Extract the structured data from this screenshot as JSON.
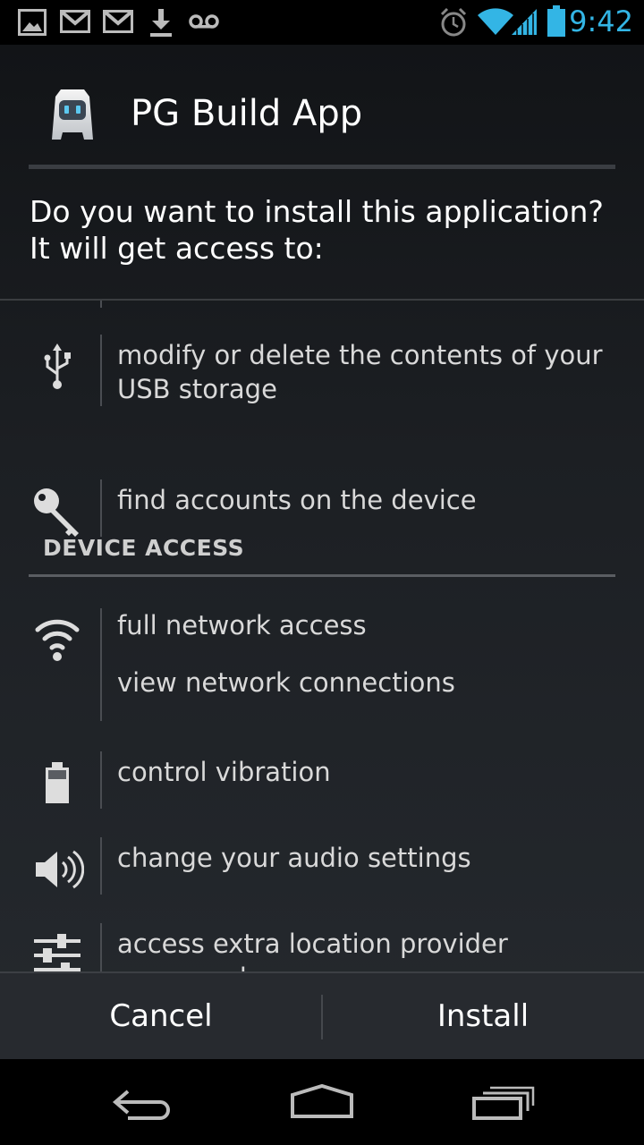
{
  "status_bar": {
    "time": "9:42",
    "left_icons": [
      "image-icon",
      "gmail-icon",
      "gmail-icon",
      "download-icon",
      "voicemail-icon"
    ],
    "right_icons": [
      "alarm-icon",
      "wifi-icon",
      "signal-icon",
      "battery-icon"
    ],
    "accent_color": "#33b5e5"
  },
  "header": {
    "app_name": "PG Build App",
    "app_icon": "phonegap-robot-icon"
  },
  "question": "Do you want to install this application? It will get access to:",
  "permissions_top": [
    {
      "icon": "usb-icon",
      "lines": [
        "modify or delete the contents of your USB storage"
      ]
    },
    {
      "icon": "key-icon",
      "lines": [
        "find accounts on the device"
      ]
    }
  ],
  "device_access": {
    "title": "DEVICE ACCESS",
    "items": [
      {
        "icon": "wifi-signal-icon",
        "lines": [
          "full network access",
          "view network connections"
        ]
      },
      {
        "icon": "battery-icon",
        "lines": [
          "control vibration"
        ]
      },
      {
        "icon": "speaker-icon",
        "lines": [
          "change your audio settings"
        ]
      },
      {
        "icon": "sliders-icon",
        "lines": [
          "access extra location provider commands"
        ]
      }
    ]
  },
  "buttons": {
    "cancel": "Cancel",
    "install": "Install"
  },
  "nav_bar": {
    "icons": [
      "back-icon",
      "home-icon",
      "recent-apps-icon"
    ]
  }
}
